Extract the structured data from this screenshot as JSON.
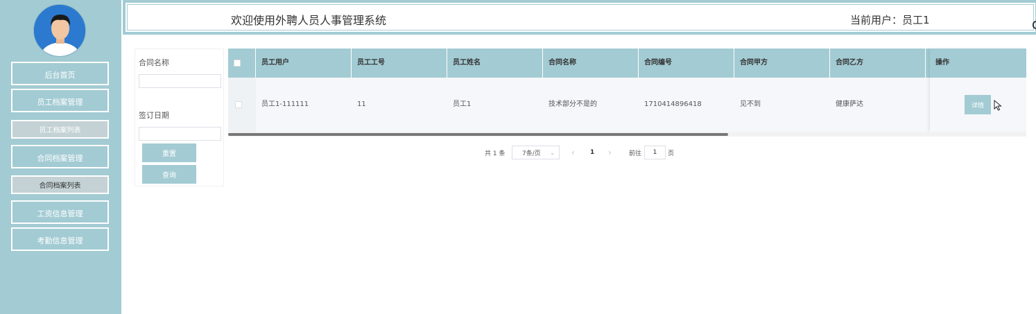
{
  "header": {
    "title": "欢迎使用外聘人员人事管理系统",
    "current_user_label": "当前用户：员工1"
  },
  "sidebar": {
    "items": [
      {
        "label": "后台首页"
      },
      {
        "label": "员工档案管理"
      },
      {
        "label": "员工档案列表"
      },
      {
        "label": "合同档案管理"
      },
      {
        "label": "合同档案列表"
      },
      {
        "label": "工资信息管理"
      },
      {
        "label": "考勤信息管理"
      }
    ]
  },
  "search": {
    "contract_name_label": "合同名称",
    "contract_name_value": "",
    "sign_date_label": "签订日期",
    "sign_date_value": "",
    "reset_label": "重置",
    "query_label": "查询"
  },
  "table": {
    "columns": [
      "员工用户",
      "员工工号",
      "员工姓名",
      "合同名称",
      "合同编号",
      "合同甲方",
      "合同乙方"
    ],
    "ops_header": "操作",
    "rows": [
      {
        "cells": [
          "员工1-111111",
          "11",
          "员工1",
          "技术部分不是的",
          "1710414896418",
          "见不到",
          "健康萨达"
        ],
        "detail_label": "详情"
      }
    ]
  },
  "pagination": {
    "total_text": "共 1 条",
    "page_size": "7条/页",
    "prev": "‹",
    "current_page": "1",
    "next": "›",
    "goto_prefix": "前往",
    "goto_value": "1",
    "goto_suffix": "页"
  },
  "colors": {
    "accent": "#a3cbd3",
    "row_bg": "#f5f7fa"
  }
}
